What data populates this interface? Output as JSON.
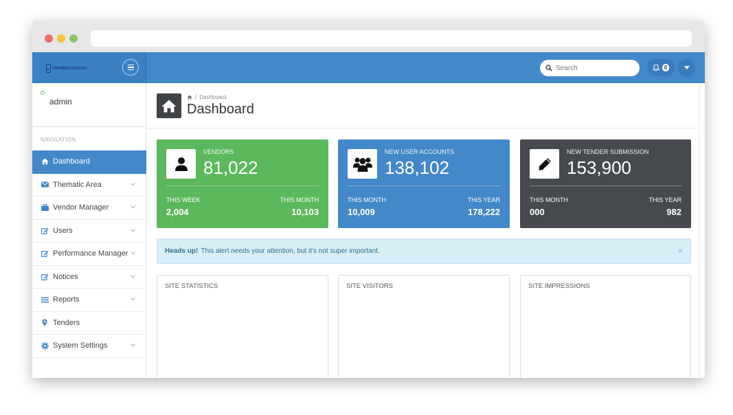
{
  "header": {
    "logo_text_bold": "Vendor",
    "logo_text_light": "Database",
    "search_placeholder": "Search",
    "notification_count": "0"
  },
  "sidebar": {
    "username": "admin",
    "nav_heading": "NAVIGATION",
    "items": [
      {
        "label": "Dashboard",
        "icon": "home-icon",
        "active": true
      },
      {
        "label": "Thematic Area",
        "icon": "envelope-icon"
      },
      {
        "label": "Vendor Manager",
        "icon": "briefcase-icon"
      },
      {
        "label": "Users",
        "icon": "edit-icon"
      },
      {
        "label": "Performance Manager",
        "icon": "edit-icon"
      },
      {
        "label": "Notices",
        "icon": "edit-icon"
      },
      {
        "label": "Reports",
        "icon": "list-icon"
      },
      {
        "label": "Tenders",
        "icon": "map-marker-icon"
      },
      {
        "label": "System Settings",
        "icon": "gear-icon"
      }
    ]
  },
  "page": {
    "breadcrumb": "Dashboard",
    "title": "Dashboard"
  },
  "stats": [
    {
      "label": "VENDORS",
      "value": "81,022",
      "left_label": "THIS WEEK",
      "left_value": "2,004",
      "right_label": "THIS MONTH",
      "right_value": "10,103",
      "color": "#5cb85c"
    },
    {
      "label": "NEW USER ACCOUNTS",
      "value": "138,102",
      "left_label": "THIS MONTH",
      "left_value": "10,009",
      "right_label": "THIS YEAR",
      "right_value": "178,222",
      "color": "#4388c9"
    },
    {
      "label": "NEW TENDER SUBMISSION",
      "value": "153,900",
      "left_label": "THIS MONTH",
      "left_value": "000",
      "right_label": "THIS YEAR",
      "right_value": "982",
      "color": "#46494e"
    }
  ],
  "alert": {
    "strong": "Heads up!",
    "text": "This alert needs your attention, but it's not super important.",
    "close": "×"
  },
  "panels": [
    "SITE STATISTICS",
    "SITE VISITORS",
    "SITE IMPRESSIONS"
  ],
  "colors": {
    "accent": "#4388c9",
    "success": "#5cb85c",
    "dark": "#46494e",
    "alert_bg": "#d9edf7"
  }
}
